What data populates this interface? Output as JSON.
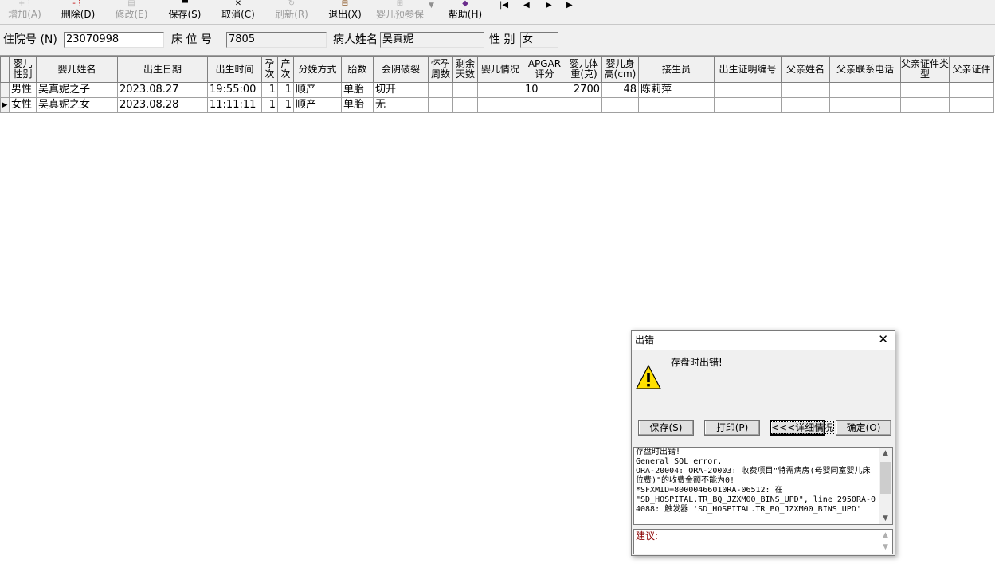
{
  "toolbar": {
    "buttons": [
      {
        "label": "增加(A)",
        "icon": "add-icon",
        "enabled": false
      },
      {
        "label": "删除(D)",
        "icon": "delete-icon",
        "enabled": true
      },
      {
        "label": "修改(E)",
        "icon": "edit-icon",
        "enabled": false
      },
      {
        "label": "保存(S)",
        "icon": "save-icon",
        "enabled": true
      },
      {
        "label": "取消(C)",
        "icon": "cancel-icon",
        "enabled": true
      },
      {
        "label": "刷新(R)",
        "icon": "refresh-icon",
        "enabled": false
      },
      {
        "label": "退出(X)",
        "icon": "exit-icon",
        "enabled": true
      },
      {
        "label": "婴儿预参保",
        "icon": "insurance-icon",
        "enabled": false
      },
      {
        "label": "帮助(H)",
        "icon": "help-book-icon",
        "enabled": true
      }
    ],
    "nav": {
      "first": "|◀",
      "prev": "◀",
      "next": "▶",
      "last": "▶|"
    }
  },
  "patient": {
    "admission_label": "住院号 (N)",
    "admission_value": "23070998",
    "bed_label": "床 位 号",
    "bed_value": "7805",
    "name_label": "病人姓名",
    "name_value": "吴真妮",
    "sex_label": "性 别",
    "sex_value": "女"
  },
  "grid": {
    "columns": [
      "婴儿性别",
      "婴儿姓名",
      "出生日期",
      "出生时间",
      "孕次",
      "产次",
      "分娩方式",
      "胎数",
      "会阴破裂",
      "怀孕周数",
      "剩余天数",
      "婴儿情况",
      "APGAR评分",
      "婴儿体重(克)",
      "婴儿身高(cm)",
      "接生员",
      "出生证明编号",
      "父亲姓名",
      "父亲联系电话",
      "父亲证件类型",
      "父亲证件"
    ],
    "rows": [
      {
        "indicator": "",
        "cells": [
          "男性",
          "吴真妮之子",
          "2023.08.27",
          "19:55:00",
          "1",
          "1",
          "顺产",
          "单胎",
          "切开",
          "",
          "",
          "",
          "10",
          "2700",
          "48",
          "陈莉萍",
          "",
          "",
          "",
          "",
          ""
        ]
      },
      {
        "indicator": "▶",
        "cells": [
          "女性",
          "吴真妮之女",
          "2023.08.28",
          "11:11:11",
          "1",
          "1",
          "顺产",
          "单胎",
          "无",
          "",
          "",
          "",
          "",
          "",
          "",
          "",
          "",
          "",
          "",
          "",
          ""
        ]
      }
    ]
  },
  "dialog": {
    "title": "出错",
    "close": "✕",
    "icon": "warning-icon",
    "message": "存盘时出错!",
    "buttons": {
      "save": "保存(S)",
      "print": "打印(P)",
      "details": "<<<详细情况",
      "ok": "确定(O)"
    },
    "detail_text": "存盘时出错!\nGeneral SQL error.\nORA-20004: ORA-20003: 收费项目\"特需病房(母婴同室婴儿床位费)\"的收费金额不能为0!\n*SFXMID=80000466010RA-06512: 在\n\"SD_HOSPITAL.TR_BQ_JZXM00_BINS_UPD\", line 2950RA-04088: 触发器 'SD_HOSPITAL.TR_BQ_JZXM00_BINS_UPD'",
    "suggestion_label": "建议:"
  }
}
